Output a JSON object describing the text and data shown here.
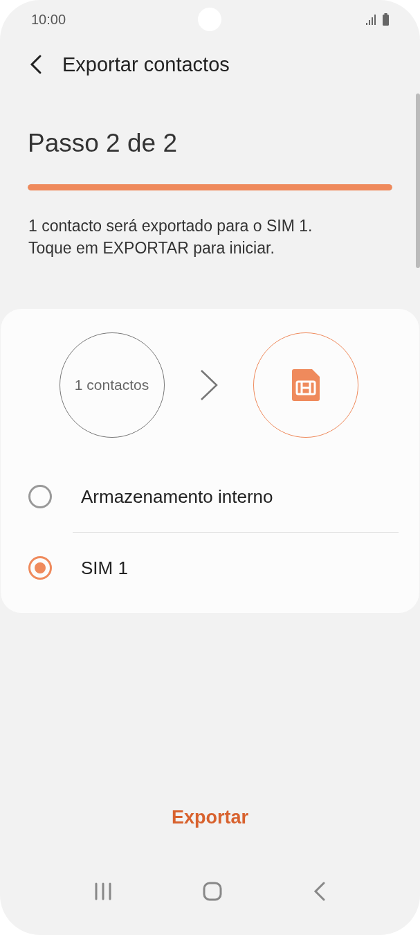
{
  "status_bar": {
    "time": "10:00"
  },
  "header": {
    "title": "Exportar contactos"
  },
  "step": {
    "title": "Passo 2 de 2",
    "level": 1
  },
  "description": "1 contacto será exportado para o SIM 1.\nToque em EXPORTAR para iniciar.",
  "transfer": {
    "source": "1 contactos"
  },
  "options": [
    {
      "label": "Armazenamento interno",
      "selected": false
    },
    {
      "label": "SIM 1",
      "selected": true
    }
  ],
  "action": {
    "label": "Exportar"
  }
}
